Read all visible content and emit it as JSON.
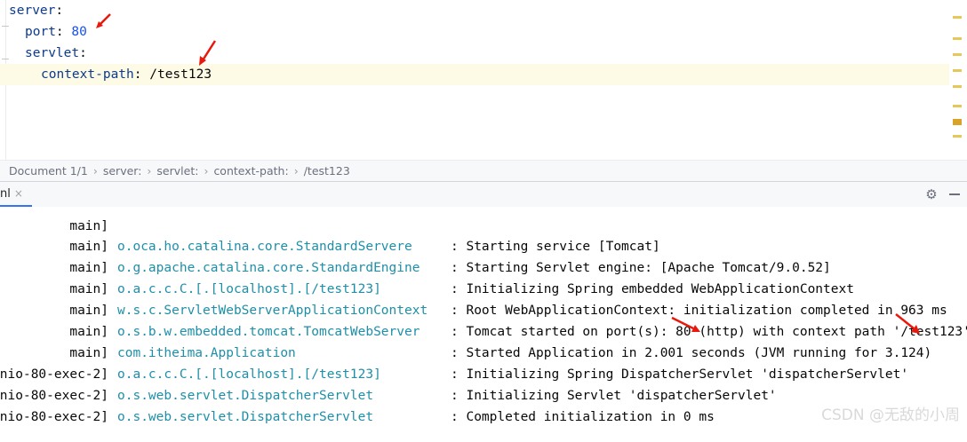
{
  "editor": {
    "lines": [
      {
        "key": "server",
        "sep": ":",
        "value": ""
      },
      {
        "key": "port",
        "sep": ": ",
        "value": "80"
      },
      {
        "key": "servlet",
        "sep": ":",
        "value": ""
      },
      {
        "key": "context-path",
        "sep": ": ",
        "value": "/test123"
      }
    ]
  },
  "breadcrumb": {
    "items": [
      "Document 1/1",
      "server:",
      "servlet:",
      "context-path:",
      "/test123"
    ]
  },
  "run_panel": {
    "tab_label": "nl",
    "close_glyph": "×",
    "gear_glyph": "⚙"
  },
  "console": {
    "lines": [
      {
        "thread": "main]",
        "logger": "o.oca.ho.catalina.core.StandardServere",
        "msg": ": Starting service [Tomcat]"
      },
      {
        "thread": "main]",
        "logger": "o.g.apache.catalina.core.StandardEngine",
        "msg": ": Starting Servlet engine: [Apache Tomcat/9.0.52]"
      },
      {
        "thread": "main]",
        "logger": "o.a.c.c.C.[.[localhost].[/test123]",
        "msg": ": Initializing Spring embedded WebApplicationContext"
      },
      {
        "thread": "main]",
        "logger": "w.s.c.ServletWebServerApplicationContext",
        "msg": ": Root WebApplicationContext: initialization completed in 963 ms"
      },
      {
        "thread": "main]",
        "logger": "o.s.b.w.embedded.tomcat.TomcatWebServer",
        "msg": ": Tomcat started on port(s): 80 (http) with context path '/test123'"
      },
      {
        "thread": "main]",
        "logger": "com.itheima.Application",
        "msg": ": Started Application in 2.001 seconds (JVM running for 3.124)"
      },
      {
        "thread": "nio-80-exec-2]",
        "logger": "o.a.c.c.C.[.[localhost].[/test123]",
        "msg": ": Initializing Spring DispatcherServlet 'dispatcherServlet'"
      },
      {
        "thread": "nio-80-exec-2]",
        "logger": "o.s.web.servlet.DispatcherServlet",
        "msg": ": Initializing Servlet 'dispatcherServlet'"
      },
      {
        "thread": "nio-80-exec-2]",
        "logger": "o.s.web.servlet.DispatcherServlet",
        "msg": ": Completed initialization in 0 ms"
      }
    ]
  },
  "watermark": "CSDN @无敌的小周",
  "colors": {
    "yaml_key": "#0d3a8c",
    "yaml_number": "#1750eb",
    "logger": "#1f8fa8",
    "annotation_arrow": "#e8180c",
    "active_line": "#fdfbe6"
  }
}
